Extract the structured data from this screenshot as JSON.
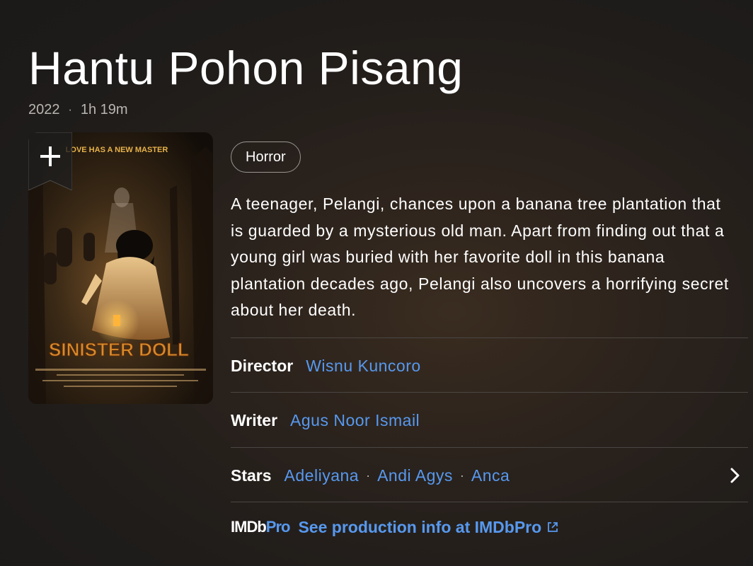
{
  "title": "Hantu Pohon Pisang",
  "meta": {
    "year": "2022",
    "runtime": "1h 19m",
    "separator": "·"
  },
  "poster": {
    "tagline": "LOVE HAS A NEW MASTER",
    "film_title": "SINISTER DOLL",
    "add_label": "+"
  },
  "genres": [
    "Horror"
  ],
  "plot": "A teenager, Pelangi, chances upon a banana tree plantation that is guarded by a mysterious old man. Apart from finding out that a young girl was buried with her favorite doll in this banana plantation decades ago, Pelangi also uncovers a horrifying secret about her death.",
  "credits": {
    "director": {
      "label": "Director",
      "names": [
        "Wisnu Kuncoro"
      ]
    },
    "writer": {
      "label": "Writer",
      "names": [
        "Agus Noor Ismail"
      ]
    },
    "stars": {
      "label": "Stars",
      "names": [
        "Adeliyana",
        "Andi Agys",
        "Anca"
      ],
      "separator": "·"
    }
  },
  "imdbpro": {
    "logo_imdb": "IMDb",
    "logo_pro": "Pro",
    "link_text": "See production info at IMDbPro"
  },
  "colors": {
    "link": "#5799ef",
    "text": "#ffffff",
    "muted": "#b9b6b2"
  },
  "icons": {
    "watchlist": "plus-icon",
    "stars_more": "chevron-right-icon",
    "external": "external-link-icon"
  }
}
